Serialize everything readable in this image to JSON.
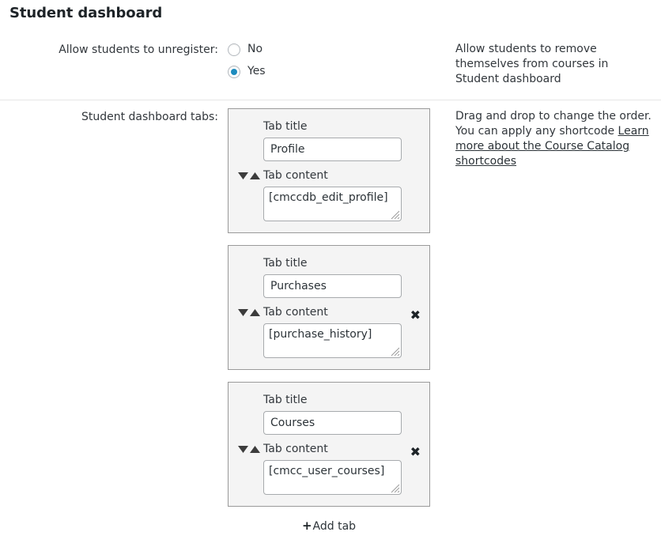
{
  "page": {
    "title": "Student dashboard"
  },
  "unregister": {
    "label": "Allow students to unregister:",
    "options": [
      {
        "value": "no",
        "label": "No",
        "checked": false
      },
      {
        "value": "yes",
        "label": "Yes",
        "checked": true
      }
    ],
    "description": "Allow students to remove themselves from courses in Student dashboard",
    "accent_color": "#1e8cbe"
  },
  "tabs_section": {
    "label": "Student dashboard tabs:",
    "field_labels": {
      "title": "Tab title",
      "content": "Tab content"
    },
    "panels": [
      {
        "title": "Profile",
        "content": "[cmccdb_edit_profile]",
        "removable": false,
        "remove_label": "✖"
      },
      {
        "title": "Purchases",
        "content": "[purchase_history]",
        "removable": true,
        "remove_label": "✖"
      },
      {
        "title": "Courses",
        "content": "[cmcc_user_courses]",
        "removable": true,
        "remove_label": "✖"
      }
    ],
    "add_tab": {
      "plus": "+",
      "label": "Add tab"
    },
    "description": {
      "line1": "Drag and drop to change the order.",
      "line2": "You can apply any shortcode",
      "link": "Learn more about the Course Catalog shortcodes"
    }
  }
}
